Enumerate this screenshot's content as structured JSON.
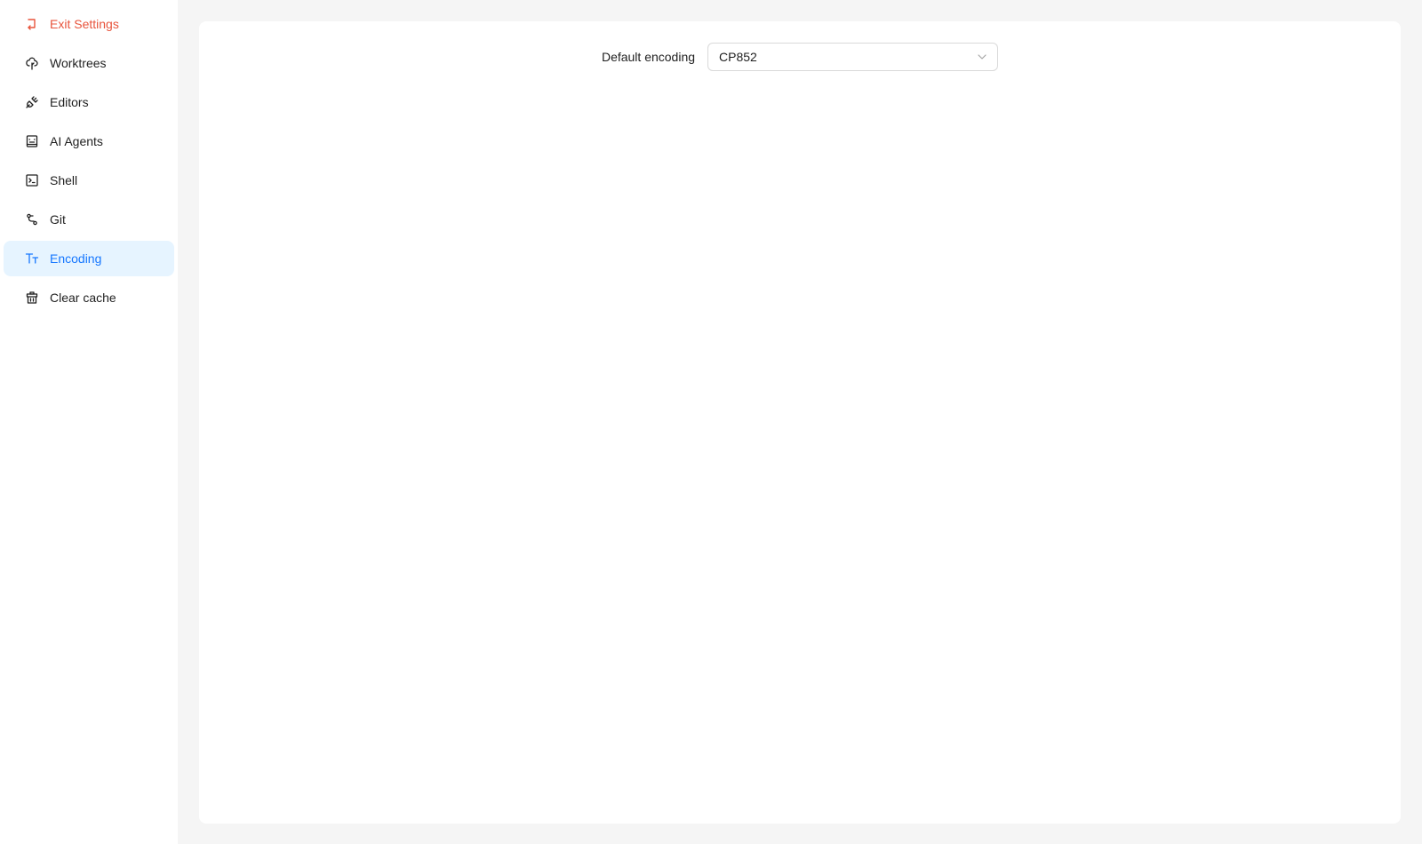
{
  "sidebar": {
    "items": [
      {
        "label": "Exit Settings",
        "icon": "exit-icon"
      },
      {
        "label": "Worktrees",
        "icon": "tree-icon"
      },
      {
        "label": "Editors",
        "icon": "plug-icon"
      },
      {
        "label": "AI Agents",
        "icon": "robot-icon"
      },
      {
        "label": "Shell",
        "icon": "terminal-icon"
      },
      {
        "label": "Git",
        "icon": "git-icon"
      },
      {
        "label": "Encoding",
        "icon": "text-size-icon"
      },
      {
        "label": "Clear cache",
        "icon": "trash-icon"
      }
    ],
    "active_item": "Encoding"
  },
  "settings": {
    "encoding_label": "Default encoding",
    "encoding_value": "CP852"
  },
  "colors": {
    "accent": "#1677ff",
    "active_bg": "#e6f4ff",
    "exit": "#e8543c",
    "page_bg": "#f5f5f5"
  }
}
